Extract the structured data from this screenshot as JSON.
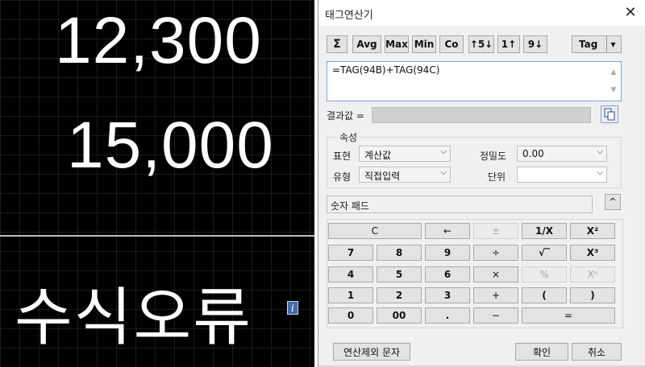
{
  "canvas": {
    "number1": "12,300",
    "number2": "15,000",
    "error_text": "수식오류",
    "info_badge": "i"
  },
  "dialog": {
    "title": "태그연산기",
    "close_icon": "close-icon",
    "toolbar": {
      "sigma": "Σ",
      "avg": "Avg",
      "max": "Max",
      "min": "Min",
      "co": "Co",
      "round5": "↑5↓",
      "roundup": "1↑",
      "rounddown": "9↓",
      "tag": "Tag",
      "tag_arrow": "▾"
    },
    "formula": "=TAG(94B)+TAG(94C)",
    "result_label": "결과값 =",
    "result_value": "",
    "copy_icon": "copy-icon",
    "properties": {
      "group_title": "속성",
      "display_label": "표현",
      "display_value": "계산값",
      "type_label": "유형",
      "type_value": "직접입력",
      "precision_label": "정밀도",
      "precision_value": "0.00",
      "unit_label": "단위",
      "unit_value": ""
    },
    "numpad_label": "숫자 패드",
    "numpad_toggle": "^",
    "keys": {
      "c": "C",
      "back": "←",
      "plusminus": "±",
      "inv": "1/X",
      "sq": "X²",
      "k7": "7",
      "k8": "8",
      "k9": "9",
      "div": "÷",
      "sqrt": "√‾",
      "cube": "X³",
      "k4": "4",
      "k5": "5",
      "k6": "6",
      "mul": "×",
      "pct": "%",
      "pow": "Xⁿ",
      "k1": "1",
      "k2": "2",
      "k3": "3",
      "plus": "+",
      "lparen": "(",
      "rparen": ")",
      "k0": "0",
      "k00": "00",
      "dot": ".",
      "minus": "−",
      "eq": "="
    },
    "exclude_text_button": "연산제외 문자",
    "ok_button": "확인",
    "cancel_button": "취소"
  }
}
